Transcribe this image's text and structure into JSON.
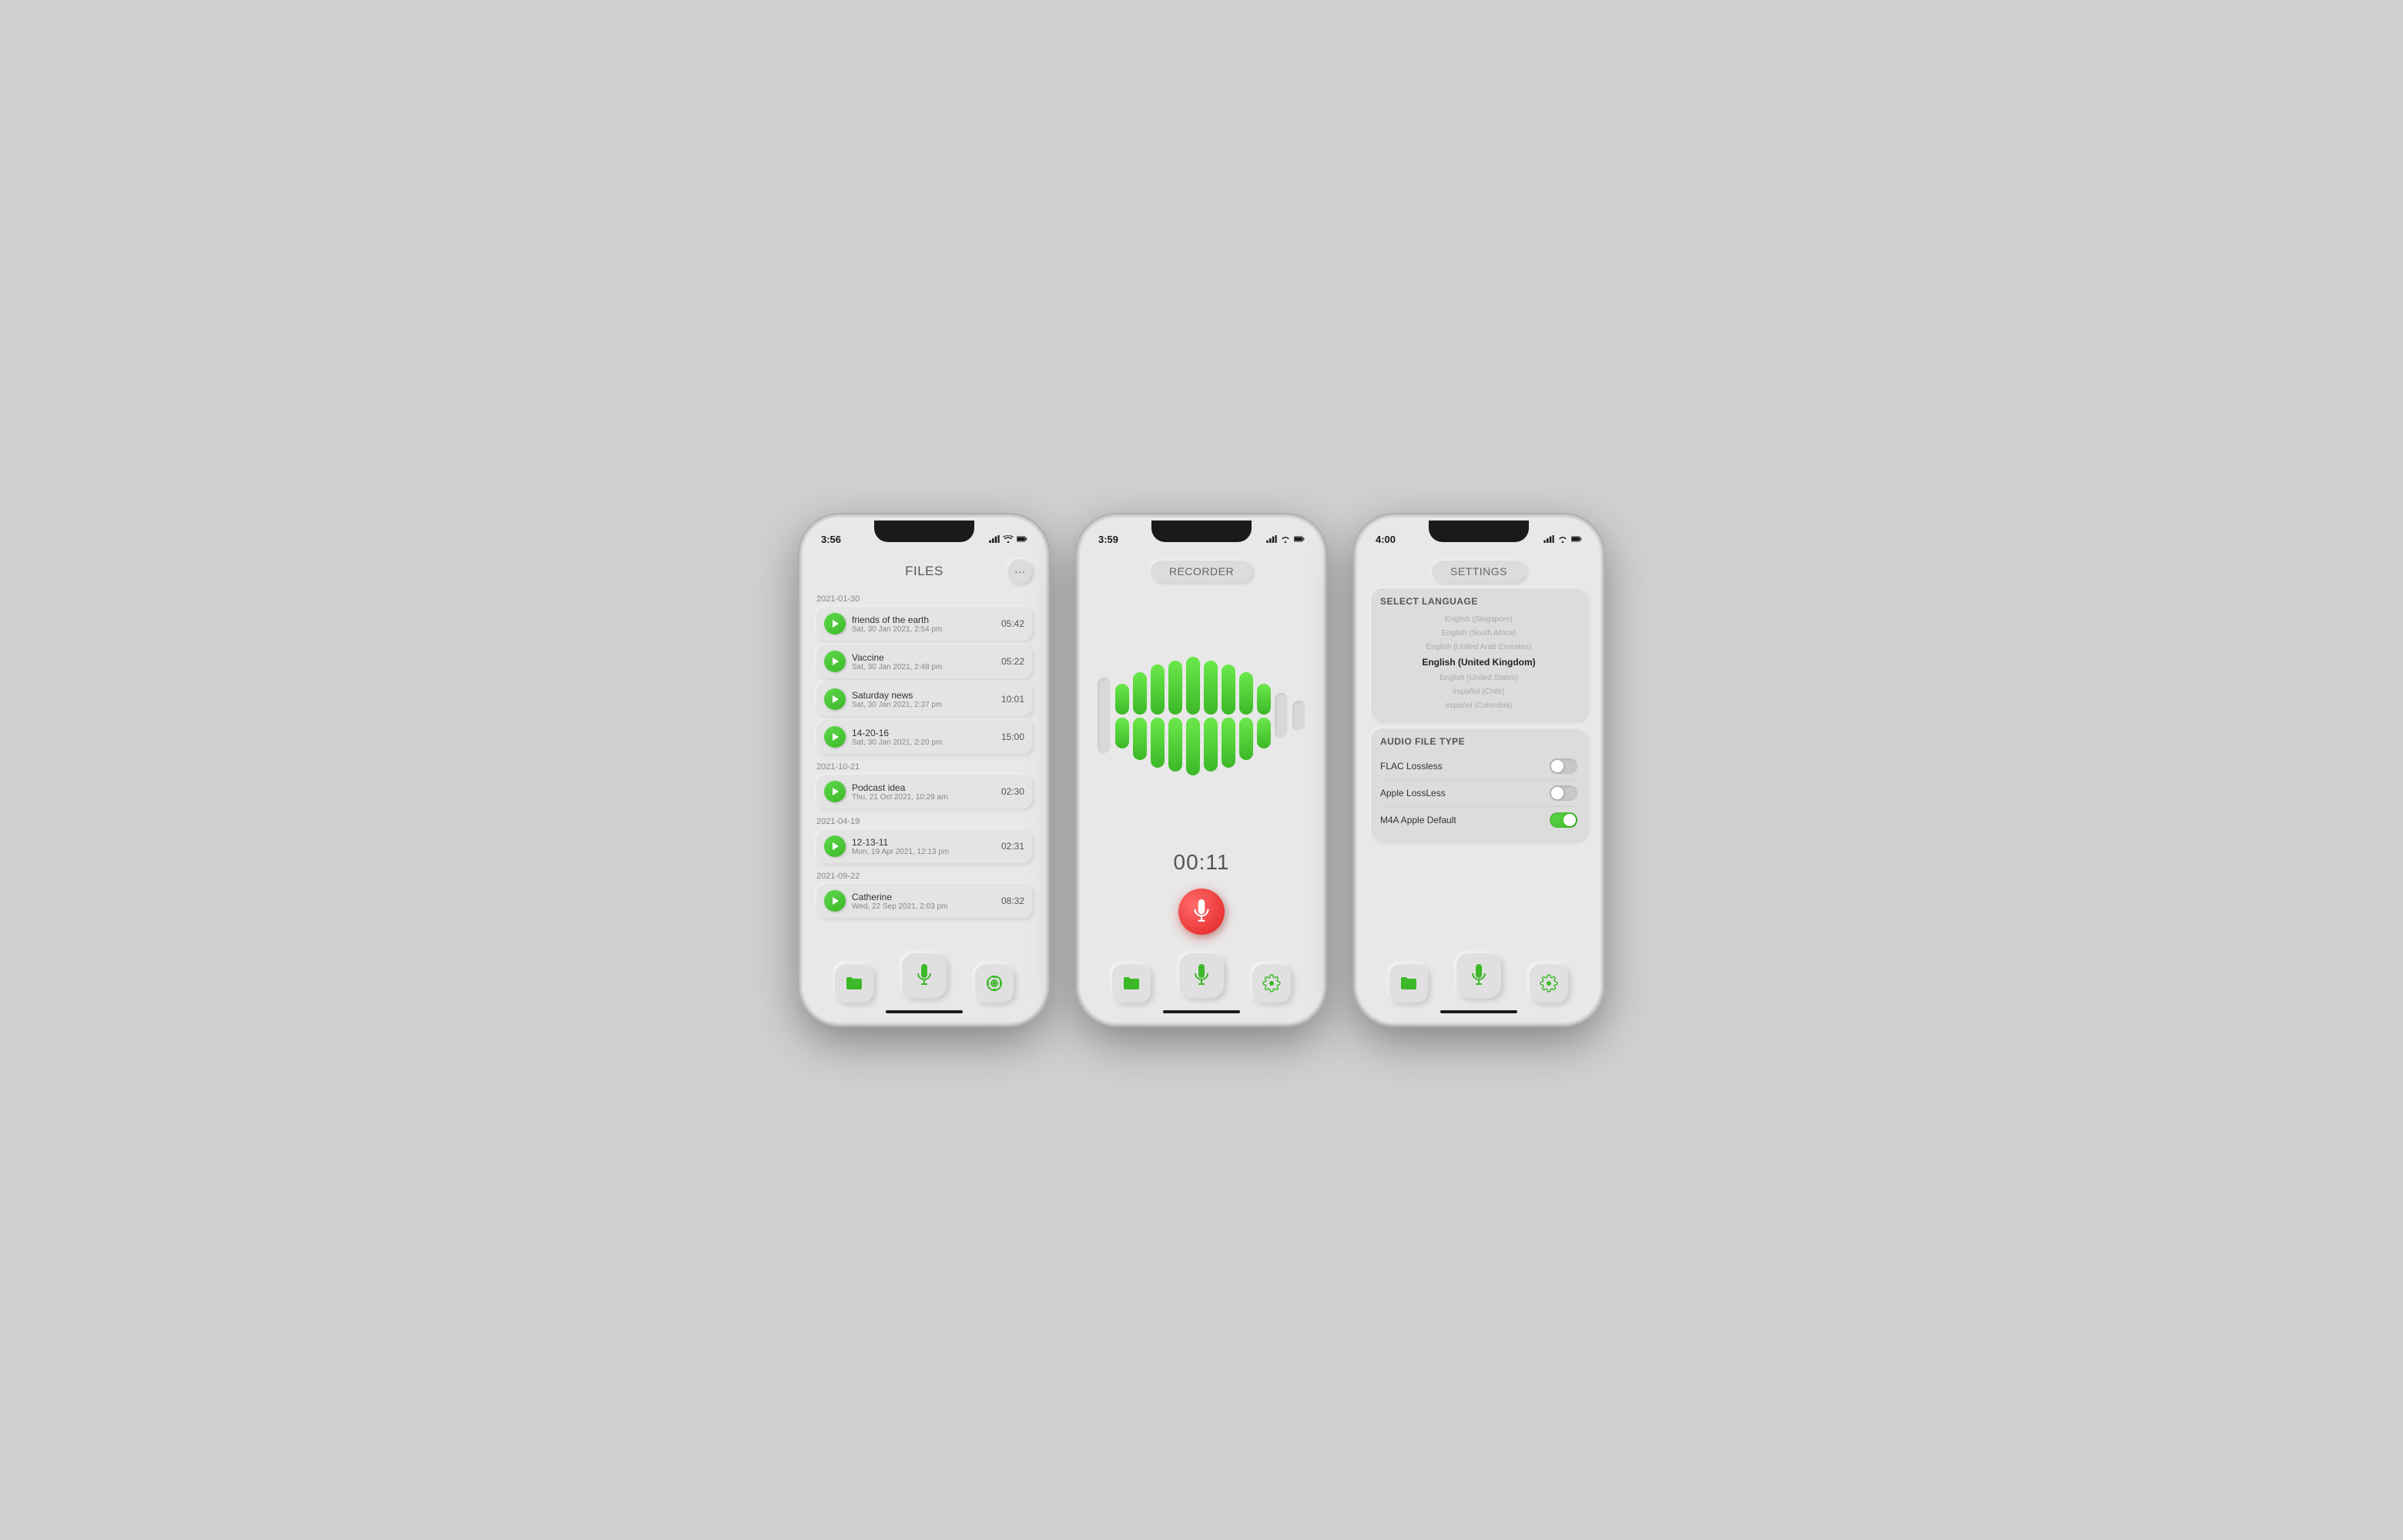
{
  "phones": [
    {
      "id": "files",
      "status_time": "3:56",
      "title": "FILES",
      "sections": [
        {
          "date": "2021-01-30",
          "items": [
            {
              "name": "friends of the earth",
              "date": "Sat, 30 Jan 2021, 2:54 pm",
              "duration": "05:42"
            },
            {
              "name": "Vaccine",
              "date": "Sat, 30 Jan 2021, 2:48 pm",
              "duration": "05:22"
            },
            {
              "name": "Saturday news",
              "date": "Sat, 30 Jan 2021, 2:37 pm",
              "duration": "10:01"
            },
            {
              "name": "14-20-16",
              "date": "Sat, 30 Jan 2021, 2:20 pm",
              "duration": "15:00"
            }
          ]
        },
        {
          "date": "2021-10-21",
          "items": [
            {
              "name": "Podcast idea",
              "date": "Thu, 21 Oct 2021, 10:29 am",
              "duration": "02:30"
            }
          ]
        },
        {
          "date": "2021-04-19",
          "items": [
            {
              "name": "12-13-11",
              "date": "Mon, 19 Apr 2021, 12:13 pm",
              "duration": "02:31"
            }
          ]
        },
        {
          "date": "2021-09-22",
          "items": [
            {
              "name": "Catherine",
              "date": "Wed, 22 Sep 2021, 2:03 pm",
              "duration": "08:32"
            }
          ]
        }
      ]
    },
    {
      "id": "recorder",
      "status_time": "3:59",
      "title": "RECORDER",
      "timer": "00:11"
    },
    {
      "id": "settings",
      "status_time": "4:00",
      "title": "SETTINGS",
      "select_language_label": "SELECT LANGUAGE",
      "languages": [
        {
          "name": "English (Singapore)",
          "selected": false
        },
        {
          "name": "English (South Africa)",
          "selected": false
        },
        {
          "name": "English (United Arab Emirates)",
          "selected": false
        },
        {
          "name": "English (United Kingdom)",
          "selected": true
        },
        {
          "name": "English (United States)",
          "selected": false
        },
        {
          "name": "español (Chile)",
          "selected": false
        },
        {
          "name": "español (Colombia)",
          "selected": false
        }
      ],
      "audio_file_type_label": "AUDIO FILE TYPE",
      "audio_types": [
        {
          "name": "FLAC Lossless",
          "on": false
        },
        {
          "name": "Apple LossLess",
          "on": false
        },
        {
          "name": "M4A Apple Default",
          "on": true
        }
      ]
    }
  ],
  "icons": {
    "more": "···",
    "folder": "📁",
    "mic": "🎤",
    "gear": "⚙"
  }
}
